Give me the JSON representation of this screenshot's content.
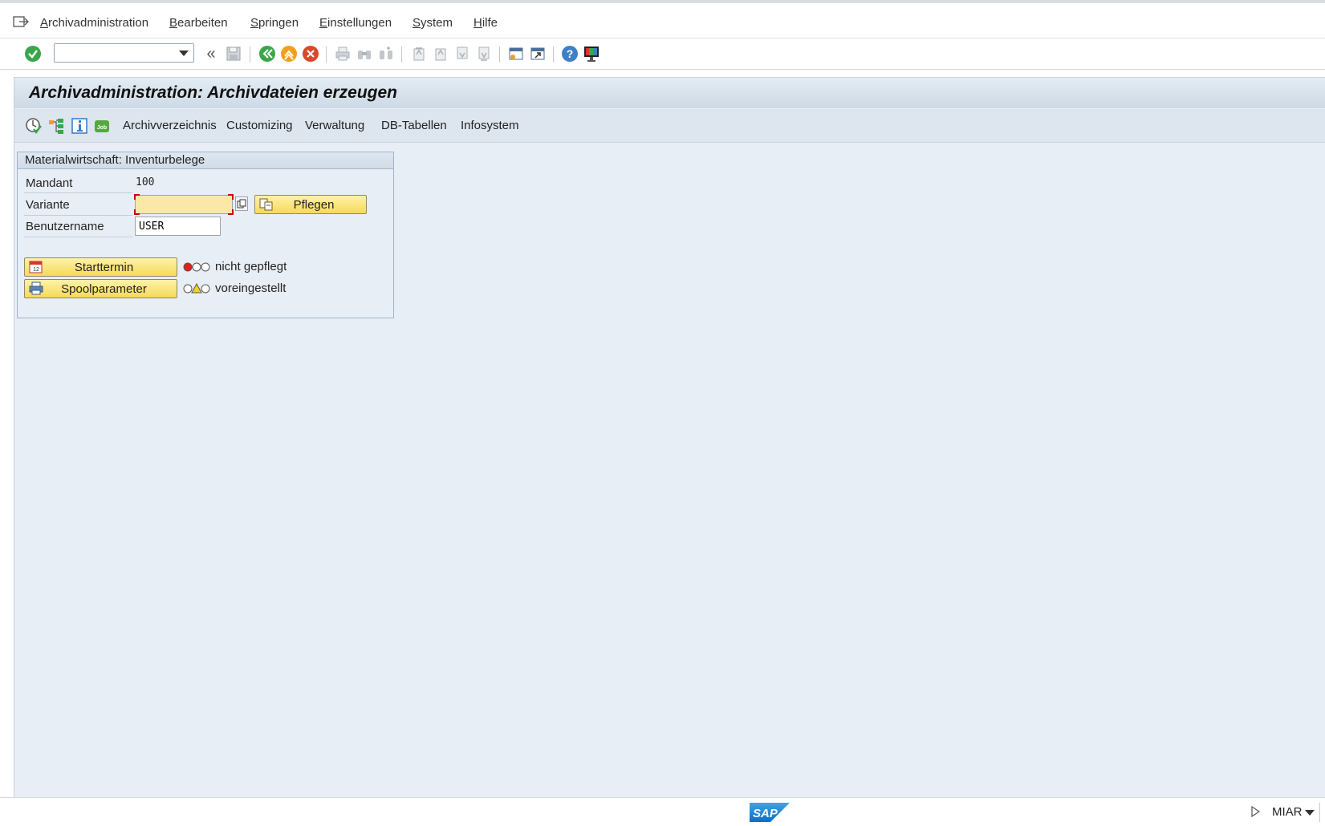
{
  "menu": {
    "items": [
      {
        "id": "archivadministration",
        "mnemonic": "A",
        "rest": "rchivadministration"
      },
      {
        "id": "bearbeiten",
        "mnemonic": "B",
        "rest": "earbeiten"
      },
      {
        "id": "springen",
        "mnemonic": "S",
        "rest": "pringen"
      },
      {
        "id": "einstellungen",
        "mnemonic": "E",
        "rest": "instellungen"
      },
      {
        "id": "system",
        "mnemonic": "S",
        "rest": "ystem"
      },
      {
        "id": "hilfe",
        "mnemonic": "H",
        "rest": "ilfe"
      }
    ]
  },
  "toolbar": {
    "command_value": "",
    "back_glyph": "«"
  },
  "title": "Archivadministration: Archivdateien erzeugen",
  "app_toolbar": {
    "links": [
      "Archivverzeichnis",
      "Customizing",
      "Verwaltung",
      "DB-Tabellen",
      "Infosystem"
    ]
  },
  "group": {
    "header": "Materialwirtschaft: Inventurbelege",
    "mandant_label": "Mandant",
    "mandant_value": "100",
    "variante_label": "Variante",
    "variante_value": "",
    "pflegen_label": "Pflegen",
    "benutzer_label": "Benutzername",
    "benutzer_value": "USER",
    "starttermin_label": "Starttermin",
    "starttermin_status": "nicht gepflegt",
    "spool_label": "Spoolparameter",
    "spool_status": "voreingestellt"
  },
  "statusbar": {
    "logo": "SAP",
    "system": "MIAR"
  },
  "colors": {
    "accent_yellow": "#f6d95a",
    "field_required": "#fbe8a8",
    "background": "#e8eef5",
    "light_red": "#e0201b",
    "light_yellow": "#f2d21b"
  }
}
